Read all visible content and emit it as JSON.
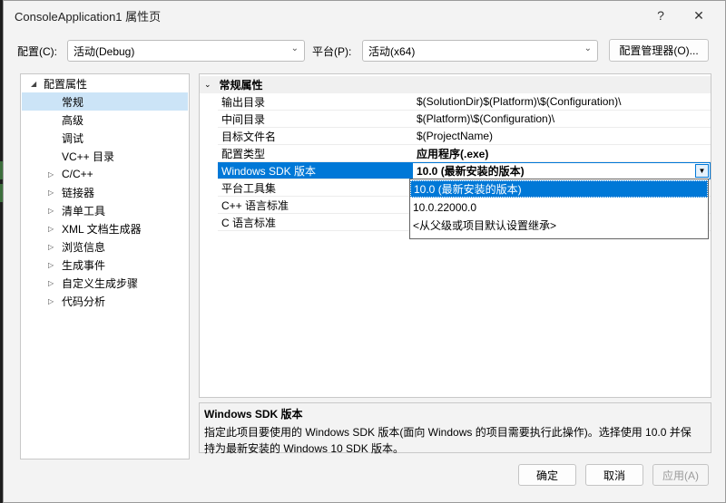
{
  "window": {
    "title": "ConsoleApplication1 属性页"
  },
  "titlebar": {
    "help": "?",
    "close": "✕"
  },
  "toolbar": {
    "config_label": "配置(C):",
    "config_value": "活动(Debug)",
    "platform_label": "平台(P):",
    "platform_value": "活动(x64)",
    "config_manager": "配置管理器(O)..."
  },
  "tree": {
    "root": "配置属性",
    "items": [
      "常规",
      "高级",
      "调试",
      "VC++ 目录",
      "C/C++",
      "链接器",
      "清单工具",
      "XML 文档生成器",
      "浏览信息",
      "生成事件",
      "自定义生成步骤",
      "代码分析"
    ]
  },
  "grid": {
    "category": "常规属性",
    "rows": [
      {
        "name": "输出目录",
        "value": "$(SolutionDir)$(Platform)\\$(Configuration)\\"
      },
      {
        "name": "中间目录",
        "value": "$(Platform)\\$(Configuration)\\"
      },
      {
        "name": "目标文件名",
        "value": "$(ProjectName)"
      },
      {
        "name": "配置类型",
        "value": "应用程序(.exe)"
      },
      {
        "name": "Windows SDK 版本",
        "value": "10.0 (最新安装的版本)"
      },
      {
        "name": "平台工具集",
        "value": ""
      },
      {
        "name": "C++ 语言标准",
        "value": ""
      },
      {
        "name": "C 语言标准",
        "value": ""
      }
    ]
  },
  "dropdown": {
    "options": [
      "10.0 (最新安装的版本)",
      "10.0.22000.0",
      "<从父级或项目默认设置继承>"
    ]
  },
  "description": {
    "title": "Windows SDK 版本",
    "line1": "指定此项目要使用的 Windows SDK 版本(面向 Windows 的项目需要执行此操作)。选择使用 10.0 并保",
    "line2": "持为最新安装的 Windows 10 SDK 版本。"
  },
  "buttons": {
    "ok": "确定",
    "cancel": "取消",
    "apply": "应用(A)"
  },
  "icons": {
    "expanded": "expanded-triangle-icon",
    "collapsed": "collapsed-triangle-icon",
    "dropdown": "chevron-down-icon"
  }
}
